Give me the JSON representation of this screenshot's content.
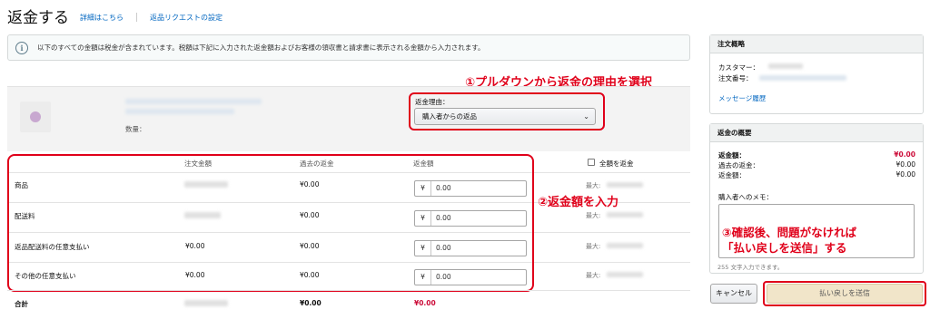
{
  "header": {
    "title": "返金する",
    "details_link": "詳細はこちら",
    "settings_link": "返品リクエストの設定"
  },
  "info": {
    "icon": "info-icon",
    "text": "以下のすべての金額は税金が含まれています。税額は下記に入力された返金額およびお客様の領収書と請求書に表示される金額から入力されます。"
  },
  "annotations": {
    "step1": "①プルダウンから返金の理由を選択",
    "step2": "②返金額を入力",
    "step3_line1": "③確認後、問題がなければ",
    "step3_line2": "「払い戻しを送信」する"
  },
  "product": {
    "quantity_label": "数量：",
    "reason_label": "返金理由：",
    "reason_selected": "購入者からの返品"
  },
  "table": {
    "headers": {
      "order_amount": "注文金額",
      "past_refund": "過去の返金",
      "refund_amount": "返金額",
      "full_refund": "全額を返金"
    },
    "rows": [
      {
        "label": "商品",
        "order": "",
        "past": "¥0.00",
        "currency": "¥",
        "value": "0.00",
        "max": "最大:"
      },
      {
        "label": "配送料",
        "order": "",
        "past": "¥0.00",
        "currency": "¥",
        "value": "0.00",
        "max": "最大:"
      },
      {
        "label": "返品配送料の任意支払い",
        "order": "¥0.00",
        "past": "¥0.00",
        "currency": "¥",
        "value": "0.00",
        "max": "最大:"
      },
      {
        "label": "その他の任意支払い",
        "order": "¥0.00",
        "past": "¥0.00",
        "currency": "¥",
        "value": "0.00",
        "max": "最大:"
      }
    ],
    "total": {
      "label": "合計",
      "past": "¥0.00",
      "refund": "¥0.00"
    }
  },
  "order_summary": {
    "title": "注文概略",
    "customer_label": "カスタマー：",
    "order_number_label": "注文番号：",
    "message_history": "メッセージ履歴"
  },
  "refund_summary": {
    "title": "返金の概要",
    "refund_label": "返金額：",
    "refund_value": "¥0.00",
    "past_refund_label": "過去の返金：",
    "past_refund_value": "¥0.00",
    "refund2_label": "返金額：",
    "refund2_value": "¥0.00",
    "memo_label": "購入者へのメモ：",
    "memo_hint": "255 文字入力できます。"
  },
  "buttons": {
    "cancel": "キャンセル",
    "submit": "払い戻しを送信"
  },
  "colors": {
    "annotation": "#e0001a",
    "link": "#0066c0",
    "refund_red": "#cc0c39"
  }
}
